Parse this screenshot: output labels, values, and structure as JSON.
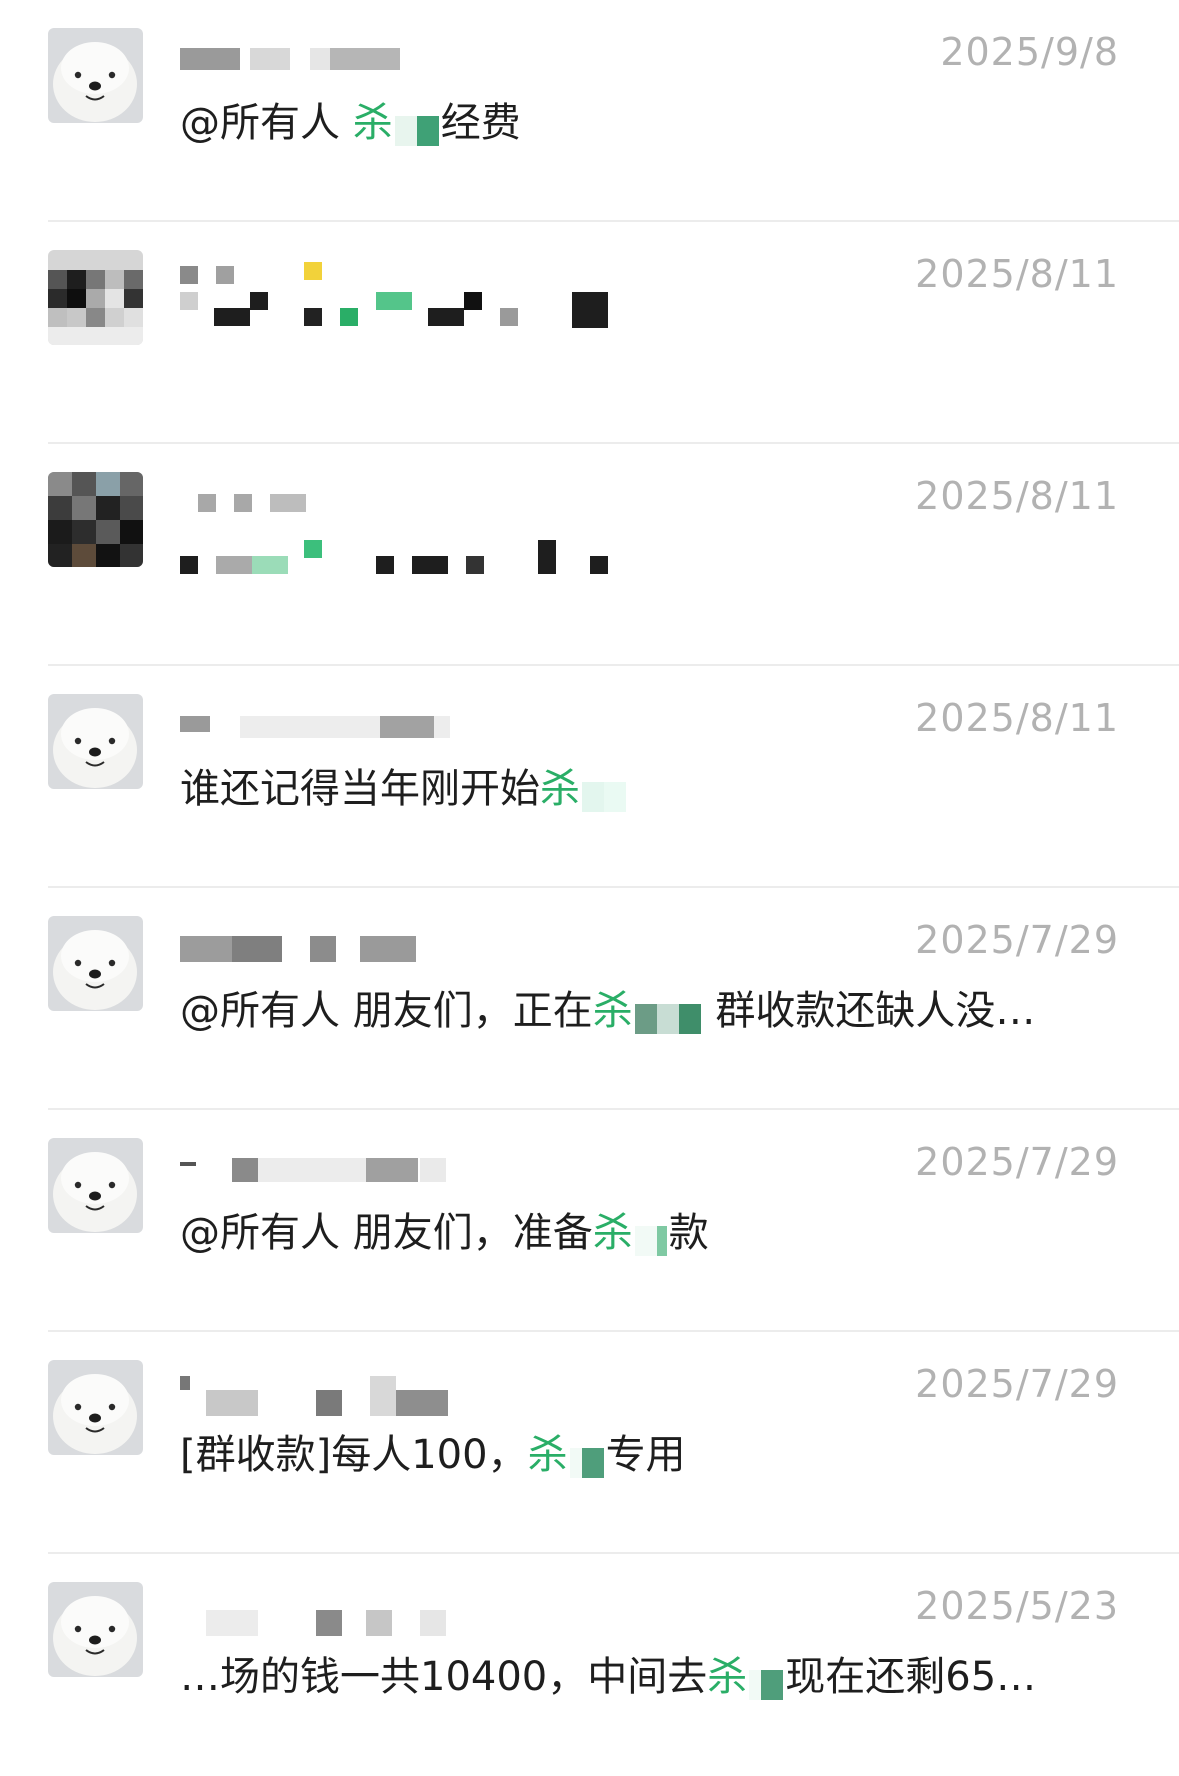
{
  "chats": [
    {
      "date": "2025/9/8",
      "avatar": "dog-avatar",
      "message": {
        "before": "@所有人 ",
        "highlight": "杀",
        "after": "经费"
      }
    },
    {
      "date": "2025/8/11",
      "avatar": "pixelated-avatar",
      "message": null
    },
    {
      "date": "2025/8/11",
      "avatar": "pixelated-avatar",
      "message": null
    },
    {
      "date": "2025/8/11",
      "avatar": "dog-avatar",
      "message": {
        "before": "谁还记得当年刚开始",
        "highlight": "杀",
        "after": ""
      }
    },
    {
      "date": "2025/7/29",
      "avatar": "dog-avatar",
      "message": {
        "before": "@所有人 朋友们，正在",
        "highlight": "杀",
        "after": " 群收款还缺人没…"
      }
    },
    {
      "date": "2025/7/29",
      "avatar": "dog-avatar",
      "message": {
        "before": "@所有人 朋友们，准备",
        "highlight": "杀",
        "after": "款"
      }
    },
    {
      "date": "2025/7/29",
      "avatar": "dog-avatar",
      "message": {
        "before": "[群收款]每人100，",
        "highlight": "杀",
        "after": "专用"
      }
    },
    {
      "date": "2025/5/23",
      "avatar": "dog-avatar",
      "message": {
        "before": "…场的钱一共10400，中间去",
        "highlight": "杀",
        "after": "现在还剩65…"
      }
    }
  ],
  "colors": {
    "highlight": "#2aae67",
    "date": "#b2b2b2",
    "divider": "#ececec"
  }
}
